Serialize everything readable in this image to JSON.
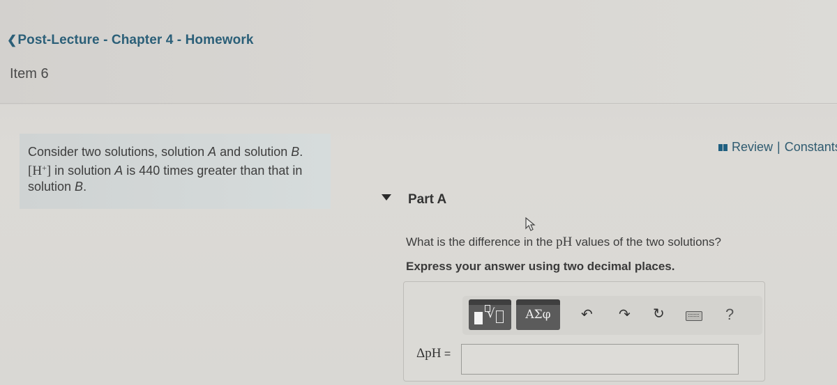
{
  "header": {
    "back_link": "Post-Lecture - Chapter 4 - Homework",
    "item_label": "Item 6"
  },
  "problem": {
    "line1_pre": "Consider two solutions, solution ",
    "line1_varA": "A",
    "line1_mid": " and solution ",
    "line1_varB": "B",
    "line1_end": ".",
    "h_bracket": "[H",
    "h_sup": "+",
    "h_close": "]",
    "line2_pre": " in solution ",
    "line2_varA": "A",
    "line2_post": " is 440 times greater than that in",
    "line3_pre": "solution ",
    "line3_varB": "B",
    "line3_end": "."
  },
  "resources": {
    "review": "Review",
    "separator": "|",
    "constants": "Constants"
  },
  "part": {
    "title": "Part A",
    "question_pre": "What is the difference in the ",
    "question_ph": "pH",
    "question_post": " values of the two solutions?",
    "instruction": "Express your answer using two decimal places."
  },
  "toolbar": {
    "templates_radical": "√",
    "symbols_label": "ΑΣφ",
    "undo_glyph": "↶",
    "redo_glyph": "↷",
    "reset_glyph": "↻",
    "help_glyph": "?"
  },
  "answer": {
    "label": "ΔpH",
    "equals": " =",
    "value": "",
    "placeholder": ""
  }
}
